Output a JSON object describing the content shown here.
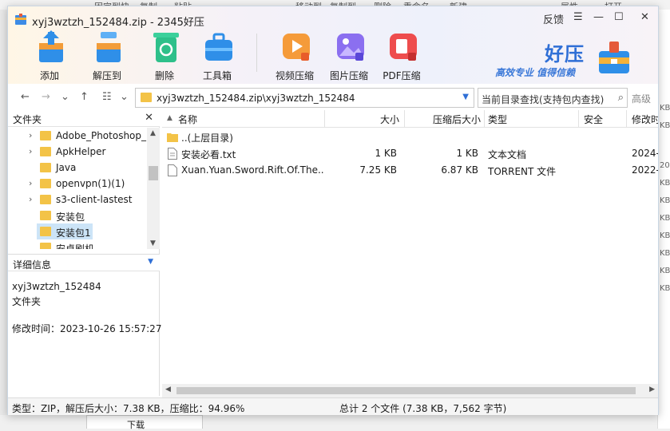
{
  "background": {
    "top_items": [
      "固定到快",
      "复制",
      "粘贴",
      "移动到",
      "复制到",
      "删除",
      "重命名",
      "新建",
      "属性",
      "打开"
    ],
    "right_items": [
      "KB",
      "KB",
      "20",
      "KB",
      "KB",
      "KB",
      "KB",
      "KB",
      "KB",
      "KB"
    ],
    "bottom_item": "下载"
  },
  "window": {
    "title": "xyj3wztzh_152484.zip - 2345好压",
    "controls": {
      "feedback": "反馈",
      "menu": "☰",
      "minimize": "—",
      "maximize": "☐",
      "close": "✕"
    }
  },
  "toolbar": [
    {
      "label": "添加",
      "icon": "add-icon"
    },
    {
      "label": "解压到",
      "icon": "extract-icon"
    },
    {
      "label": "删除",
      "icon": "recycle-icon"
    },
    {
      "label": "工具箱",
      "icon": "toolbox-icon"
    },
    {
      "label": "视频压缩",
      "icon": "video-compress-icon"
    },
    {
      "label": "图片压缩",
      "icon": "image-compress-icon"
    },
    {
      "label": "PDF压缩",
      "icon": "pdf-compress-icon"
    }
  ],
  "brand": {
    "name": "好压",
    "slogan": "高效专业  值得信赖"
  },
  "address": {
    "back": "←",
    "forward": "→",
    "dropdown": "⌄",
    "up": "↑",
    "view": "☷",
    "view_dd": "⌄",
    "path": "xyj3wztzh_152484.zip\\xyj3wztzh_152484",
    "search_placeholder": "当前目录查找(支持包内查找)",
    "advanced": "高级"
  },
  "folders_pane": {
    "title": "文件夹",
    "close": "✕",
    "items": [
      {
        "name": "Adobe_Photoshop_",
        "expandable": true,
        "selected": false
      },
      {
        "name": "ApkHelper",
        "expandable": true,
        "selected": false
      },
      {
        "name": "Java",
        "expandable": false,
        "selected": false
      },
      {
        "name": "openvpn(1)(1)",
        "expandable": true,
        "selected": false
      },
      {
        "name": "s3-client-lastest",
        "expandable": true,
        "selected": false
      },
      {
        "name": "安装包",
        "expandable": false,
        "selected": false
      },
      {
        "name": "安装包1",
        "expandable": false,
        "selected": true
      },
      {
        "name": "安卓刷机",
        "expandable": false,
        "selected": false
      }
    ]
  },
  "details_pane": {
    "title": "详细信息",
    "name": "xyj3wztzh_152484",
    "type": "文件夹",
    "modified": "修改时间：2023-10-26 15:57:27"
  },
  "file_list": {
    "columns": [
      "名称",
      "大小",
      "压缩后大小",
      "类型",
      "安全",
      "修改时"
    ],
    "rows": [
      {
        "name": "..(上层目录)",
        "size": "",
        "packed": "",
        "type": "",
        "security": "",
        "modified": "",
        "icon": "folder-icon"
      },
      {
        "name": "安装必看.txt",
        "size": "1 KB",
        "packed": "1 KB",
        "type": "文本文档",
        "security": "",
        "modified": "2024-",
        "icon": "text-file-icon"
      },
      {
        "name": "Xuan.Yuan.Sword.Rift.Of.The...",
        "size": "7.25 KB",
        "packed": "6.87 KB",
        "type": "TORRENT 文件",
        "security": "",
        "modified": "2022-",
        "icon": "file-icon"
      }
    ]
  },
  "status": {
    "left": "类型：ZIP，解压后大小：7.38 KB，压缩比：94.96%",
    "right": "总计 2 个文件 (7.38 KB，7,562 字节)"
  }
}
